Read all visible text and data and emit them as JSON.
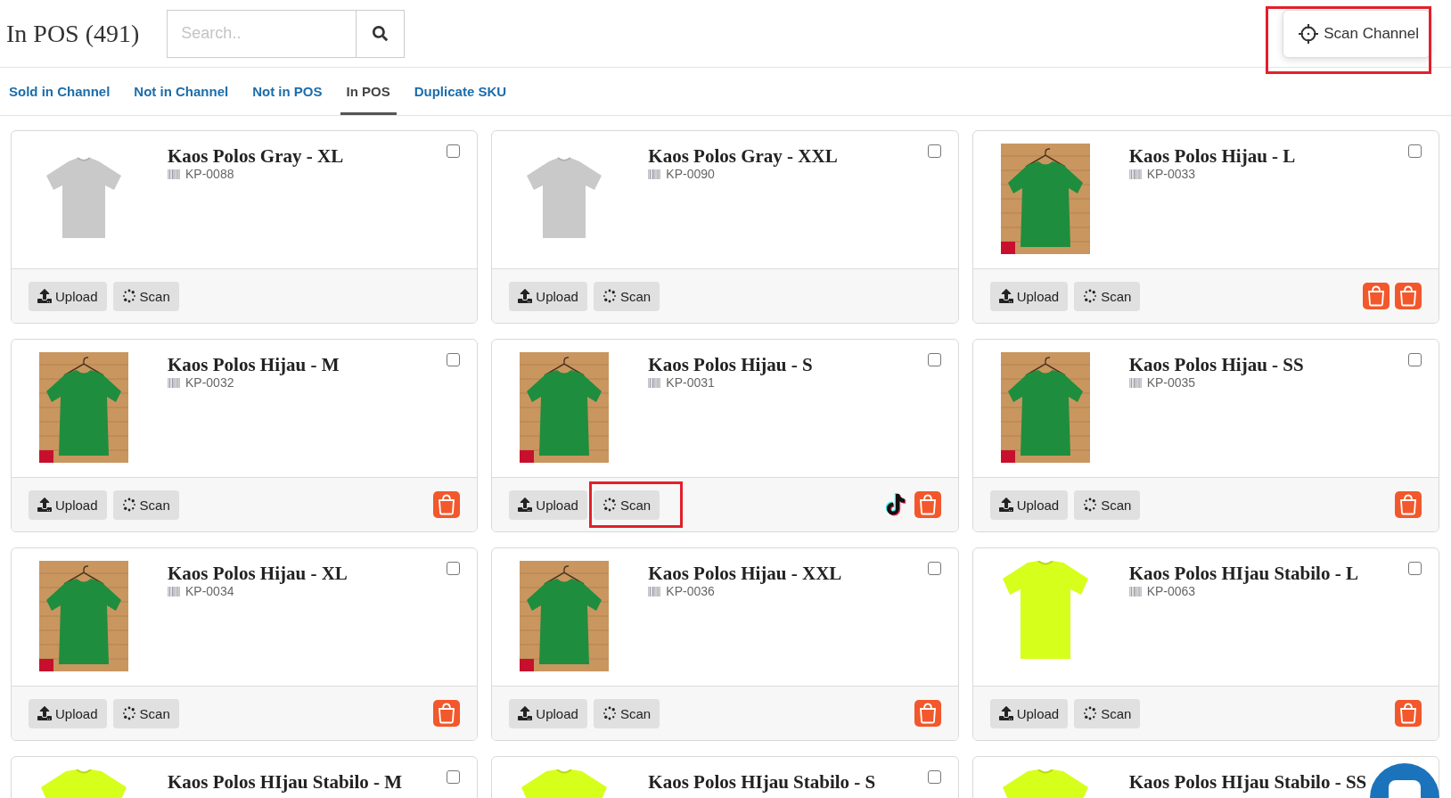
{
  "header": {
    "title": "In POS (491)",
    "search": {
      "placeholder": "Search.."
    },
    "scan_channel": {
      "label": "Scan Channel",
      "highlighted": true
    }
  },
  "tabs": [
    {
      "label": "Sold in Channel",
      "selected": false
    },
    {
      "label": "Not in Channel",
      "selected": false
    },
    {
      "label": "Not in POS",
      "selected": false
    },
    {
      "label": "In POS",
      "selected": true
    },
    {
      "label": "Duplicate SKU",
      "selected": false
    }
  ],
  "products": [
    {
      "name": "Kaos Polos Gray - XL",
      "sku": "KP-0088",
      "kind": "gray",
      "checked": false,
      "actions": [
        {
          "kind": "upload",
          "label": "Upload",
          "highlighted": false
        },
        {
          "kind": "scan",
          "label": "Scan",
          "highlighted": false
        }
      ]
    },
    {
      "name": "Kaos Polos Gray - XXL",
      "sku": "KP-0090",
      "kind": "gray",
      "checked": false,
      "actions": [
        {
          "kind": "upload",
          "label": "Upload",
          "highlighted": false
        },
        {
          "kind": "scan",
          "label": "Scan",
          "highlighted": false
        }
      ]
    },
    {
      "name": "Kaos Polos Hijau - L",
      "sku": "KP-0033",
      "kind": "green",
      "checked": false,
      "actions": [
        {
          "kind": "upload",
          "label": "Upload",
          "highlighted": false
        },
        {
          "kind": "scan",
          "label": "Scan",
          "highlighted": false
        }
      ],
      "channels": [
        {
          "kind": "shopee"
        },
        {
          "kind": "shopee"
        }
      ]
    },
    {
      "name": "Kaos Polos Hijau - M",
      "sku": "KP-0032",
      "kind": "green",
      "checked": false,
      "actions": [
        {
          "kind": "upload",
          "label": "Upload",
          "highlighted": false
        },
        {
          "kind": "scan",
          "label": "Scan",
          "highlighted": false
        }
      ],
      "channels": [
        {
          "kind": "shopee"
        }
      ]
    },
    {
      "name": "Kaos Polos Hijau - S",
      "sku": "KP-0031",
      "kind": "green",
      "checked": false,
      "actions": [
        {
          "kind": "upload",
          "label": "Upload",
          "highlighted": false
        },
        {
          "kind": "scan",
          "label": "Scan",
          "highlighted": true
        }
      ],
      "channels": [
        {
          "kind": "tiktok"
        },
        {
          "kind": "shopee"
        }
      ]
    },
    {
      "name": "Kaos Polos Hijau - SS",
      "sku": "KP-0035",
      "kind": "green",
      "checked": false,
      "actions": [
        {
          "kind": "upload",
          "label": "Upload",
          "highlighted": false
        },
        {
          "kind": "scan",
          "label": "Scan",
          "highlighted": false
        }
      ],
      "channels": [
        {
          "kind": "shopee"
        }
      ]
    },
    {
      "name": "Kaos Polos Hijau - XL",
      "sku": "KP-0034",
      "kind": "green",
      "checked": false,
      "actions": [
        {
          "kind": "upload",
          "label": "Upload",
          "highlighted": false
        },
        {
          "kind": "scan",
          "label": "Scan",
          "highlighted": false
        }
      ],
      "channels": [
        {
          "kind": "shopee"
        }
      ]
    },
    {
      "name": "Kaos Polos Hijau - XXL",
      "sku": "KP-0036",
      "kind": "green",
      "checked": false,
      "actions": [
        {
          "kind": "upload",
          "label": "Upload",
          "highlighted": false
        },
        {
          "kind": "scan",
          "label": "Scan",
          "highlighted": false
        }
      ],
      "channels": [
        {
          "kind": "shopee"
        }
      ]
    },
    {
      "name": "Kaos Polos HIjau Stabilo - L",
      "sku": "KP-0063",
      "kind": "lime",
      "checked": false,
      "actions": [
        {
          "kind": "upload",
          "label": "Upload",
          "highlighted": false
        },
        {
          "kind": "scan",
          "label": "Scan",
          "highlighted": false
        }
      ],
      "channels": [
        {
          "kind": "shopee"
        }
      ]
    },
    {
      "name": "Kaos Polos HIjau Stabilo - M",
      "kind": "lime",
      "checked": false
    },
    {
      "name": "Kaos Polos HIjau Stabilo - S",
      "kind": "lime",
      "checked": false
    },
    {
      "name": "Kaos Polos HIjau Stabilo - SS",
      "kind": "lime"
    }
  ]
}
